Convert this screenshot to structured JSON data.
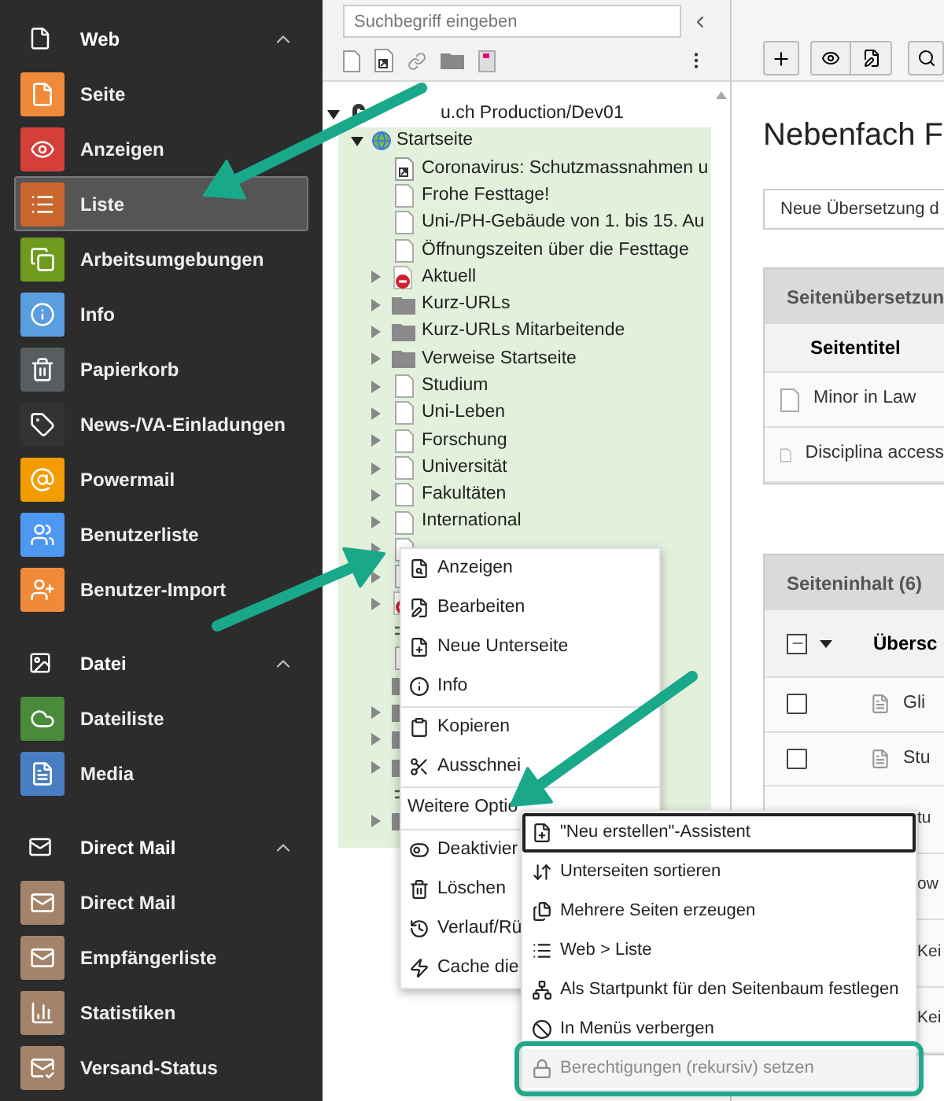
{
  "sidebar": {
    "groups": [
      {
        "label": "Web",
        "expanded": true,
        "items": [
          {
            "label": "Seite",
            "color": "#f0893a",
            "selected": false
          },
          {
            "label": "Anzeigen",
            "color": "#d43f3a",
            "selected": false
          },
          {
            "label": "Liste",
            "color": "#c9652f",
            "selected": true
          },
          {
            "label": "Arbeitsumgebungen",
            "color": "#6e9a1e",
            "selected": false
          },
          {
            "label": "Info",
            "color": "#5a9ee0",
            "selected": false
          },
          {
            "label": "Papierkorb",
            "color": "#585d60",
            "selected": false
          },
          {
            "label": "News-/VA-Einladungen",
            "color": "#333333",
            "selected": false
          },
          {
            "label": "Powermail",
            "color": "#f39c00",
            "selected": false
          },
          {
            "label": "Benutzerliste",
            "color": "#4e98f2",
            "selected": false
          },
          {
            "label": "Benutzer-Import",
            "color": "#f0893a",
            "selected": false
          }
        ]
      },
      {
        "label": "Datei",
        "expanded": true,
        "items": [
          {
            "label": "Dateiliste",
            "color": "#4a8a3a",
            "selected": false
          },
          {
            "label": "Media",
            "color": "#4a7ec2",
            "selected": false
          }
        ]
      },
      {
        "label": "Direct Mail",
        "expanded": true,
        "items": [
          {
            "label": "Direct Mail",
            "color": "#a3846a",
            "selected": false
          },
          {
            "label": "Empfängerliste",
            "color": "#a3846a",
            "selected": false
          },
          {
            "label": "Statistiken",
            "color": "#a3846a",
            "selected": false
          },
          {
            "label": "Versand-Status",
            "color": "#a3846a",
            "selected": false
          }
        ]
      }
    ]
  },
  "tree": {
    "search": {
      "placeholder": "Suchbegriff eingeben"
    },
    "root": {
      "label": "u.ch Production/Dev01",
      "expanded": true
    },
    "start": {
      "label": "Startseite",
      "expanded": true
    },
    "rows": [
      {
        "label": "Coronavirus: Schutzmassnahmen u",
        "kind": "shortcut",
        "has_children": false
      },
      {
        "label": "Frohe Festtage!",
        "kind": "page",
        "has_children": false
      },
      {
        "label": "Uni-/PH-Gebäude von 1. bis 15. Au",
        "kind": "page",
        "has_children": false
      },
      {
        "label": "Öffnungszeiten über die Festtage",
        "kind": "page",
        "has_children": false
      },
      {
        "label": "Aktuell",
        "kind": "disabled",
        "has_children": true
      },
      {
        "label": "Kurz-URLs",
        "kind": "folder",
        "has_children": true
      },
      {
        "label": "Kurz-URLs Mitarbeitende",
        "kind": "folder",
        "has_children": true
      },
      {
        "label": "Verweise Startseite",
        "kind": "folder",
        "has_children": true
      },
      {
        "label": "Studium",
        "kind": "page",
        "has_children": true
      },
      {
        "label": "Uni-Leben",
        "kind": "page",
        "has_children": true
      },
      {
        "label": "Forschung",
        "kind": "page",
        "has_children": true
      },
      {
        "label": "Universität",
        "kind": "page",
        "has_children": true
      },
      {
        "label": "Fakultäten",
        "kind": "page",
        "has_children": true
      },
      {
        "label": "International",
        "kind": "page",
        "has_children": true
      }
    ],
    "covered_rows": [
      {
        "kind": "page",
        "has_children": true
      },
      {
        "kind": "page",
        "has_children": true
      },
      {
        "kind": "disabled",
        "has_children": true
      },
      {
        "kind": "separator",
        "has_children": false
      },
      {
        "kind": "page",
        "has_children": false
      },
      {
        "kind": "folder",
        "has_children": false
      },
      {
        "kind": "folder",
        "has_children": true
      },
      {
        "kind": "folder",
        "has_children": true
      },
      {
        "kind": "folder",
        "has_children": true
      },
      {
        "kind": "separator",
        "has_children": false
      },
      {
        "kind": "folder",
        "has_children": true
      }
    ]
  },
  "context_menu": {
    "groups": [
      [
        {
          "label": "Anzeigen"
        },
        {
          "label": "Bearbeiten"
        },
        {
          "label": "Neue Unterseite"
        },
        {
          "label": "Info"
        }
      ],
      [
        {
          "label": "Kopieren"
        },
        {
          "label": "Ausschnei"
        }
      ],
      [
        {
          "label": "Weitere Optio"
        }
      ],
      [
        {
          "label": "Deaktivier"
        },
        {
          "label": "Löschen"
        },
        {
          "label": "Verlauf/Rü"
        },
        {
          "label": "Cache die"
        }
      ]
    ]
  },
  "submenu": {
    "items": [
      {
        "label": "\"Neu erstellen\"-Assistent",
        "focused": true,
        "disabled": false,
        "highlighted": false
      },
      {
        "label": "Unterseiten sortieren",
        "focused": false,
        "disabled": false,
        "highlighted": false
      },
      {
        "label": "Mehrere Seiten erzeugen",
        "focused": false,
        "disabled": false,
        "highlighted": false
      },
      {
        "label": "Web > Liste",
        "focused": false,
        "disabled": false,
        "highlighted": false
      },
      {
        "label": "Als Startpunkt für den Seitenbaum festlegen",
        "focused": false,
        "disabled": false,
        "highlighted": false
      },
      {
        "label": "In Menüs verbergen",
        "focused": false,
        "disabled": false,
        "highlighted": false
      },
      {
        "label": "Berechtigungen (rekursiv) setzen",
        "focused": false,
        "disabled": true,
        "highlighted": true
      }
    ]
  },
  "content": {
    "title": "Nebenfach F",
    "language_select": "Neue Übersetzung d",
    "translations": {
      "title": "Seitenübersetzun",
      "column": "Seitentitel",
      "rows": [
        "Minor in Law",
        "Disciplina access"
      ]
    },
    "elements": {
      "title": "Seiteninhalt (6)",
      "column": "Übersc",
      "rows": [
        {
          "text": "Gli",
          "checked": false
        },
        {
          "text": "Stu",
          "checked": false
        },
        {
          "text": "tu"
        },
        {
          "text": "ow"
        },
        {
          "text": "Kei"
        },
        {
          "text": "Kei"
        }
      ]
    }
  }
}
